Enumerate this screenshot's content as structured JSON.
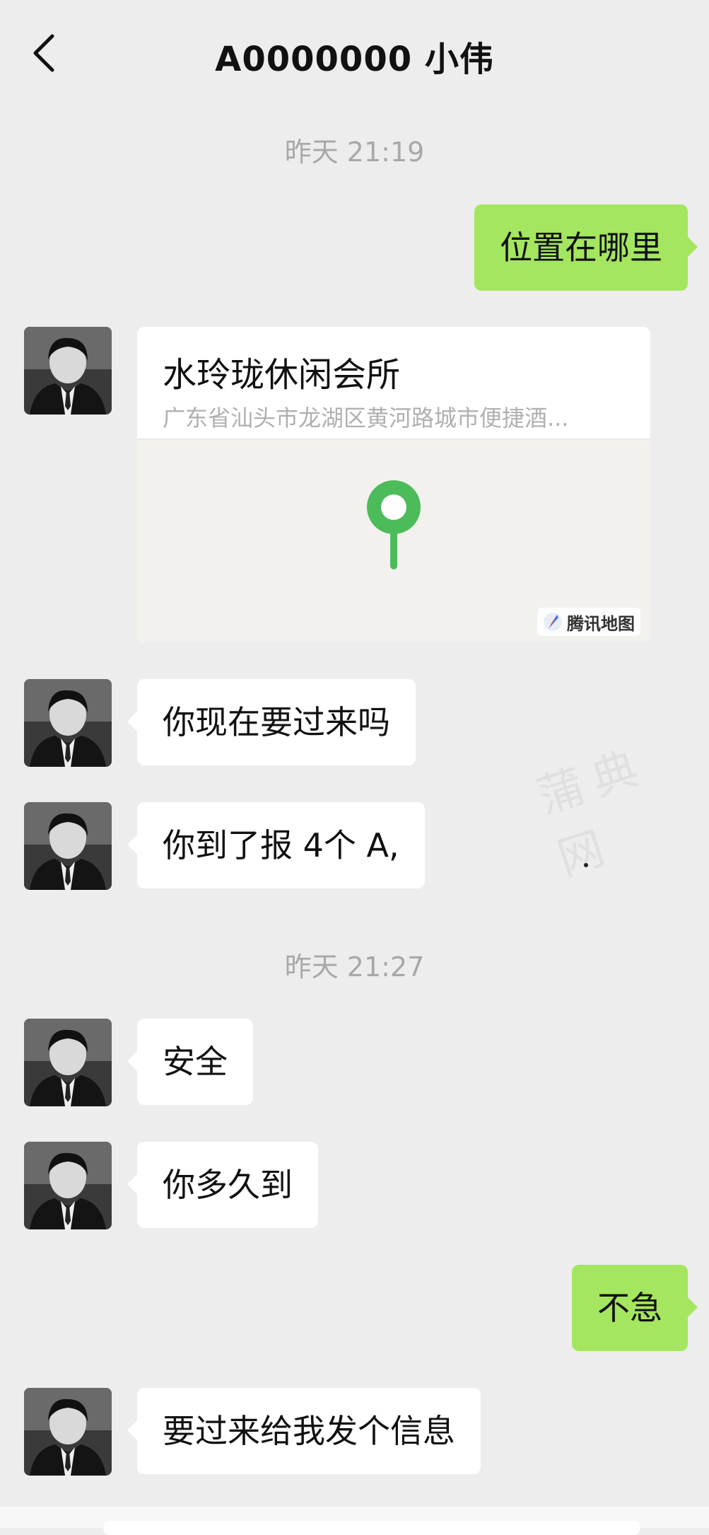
{
  "header": {
    "title": "A0000000 小伟",
    "back_icon": "chevron-left-icon"
  },
  "messages": {
    "ts1": "昨天 21:19",
    "m1": "位置在哪里",
    "location": {
      "name": "水玲珑休闲会所",
      "address": "广东省汕头市龙湖区黄河路城市便捷酒...",
      "map_brand": "腾讯地图",
      "pin_color": "#4cbb5a"
    },
    "m2": "你现在要过来吗",
    "m3": "你到了报 4个 A,",
    "ts2": "昨天 21:27",
    "m4": "安全",
    "m5": "你多久到",
    "m6": "不急",
    "m7": "要过来给我发个信息"
  },
  "watermark": "蒲典网",
  "colors": {
    "background": "#ededed",
    "outgoing_bubble": "#a4e65f",
    "incoming_bubble": "#ffffff",
    "timestamp": "#a8a8a8"
  }
}
